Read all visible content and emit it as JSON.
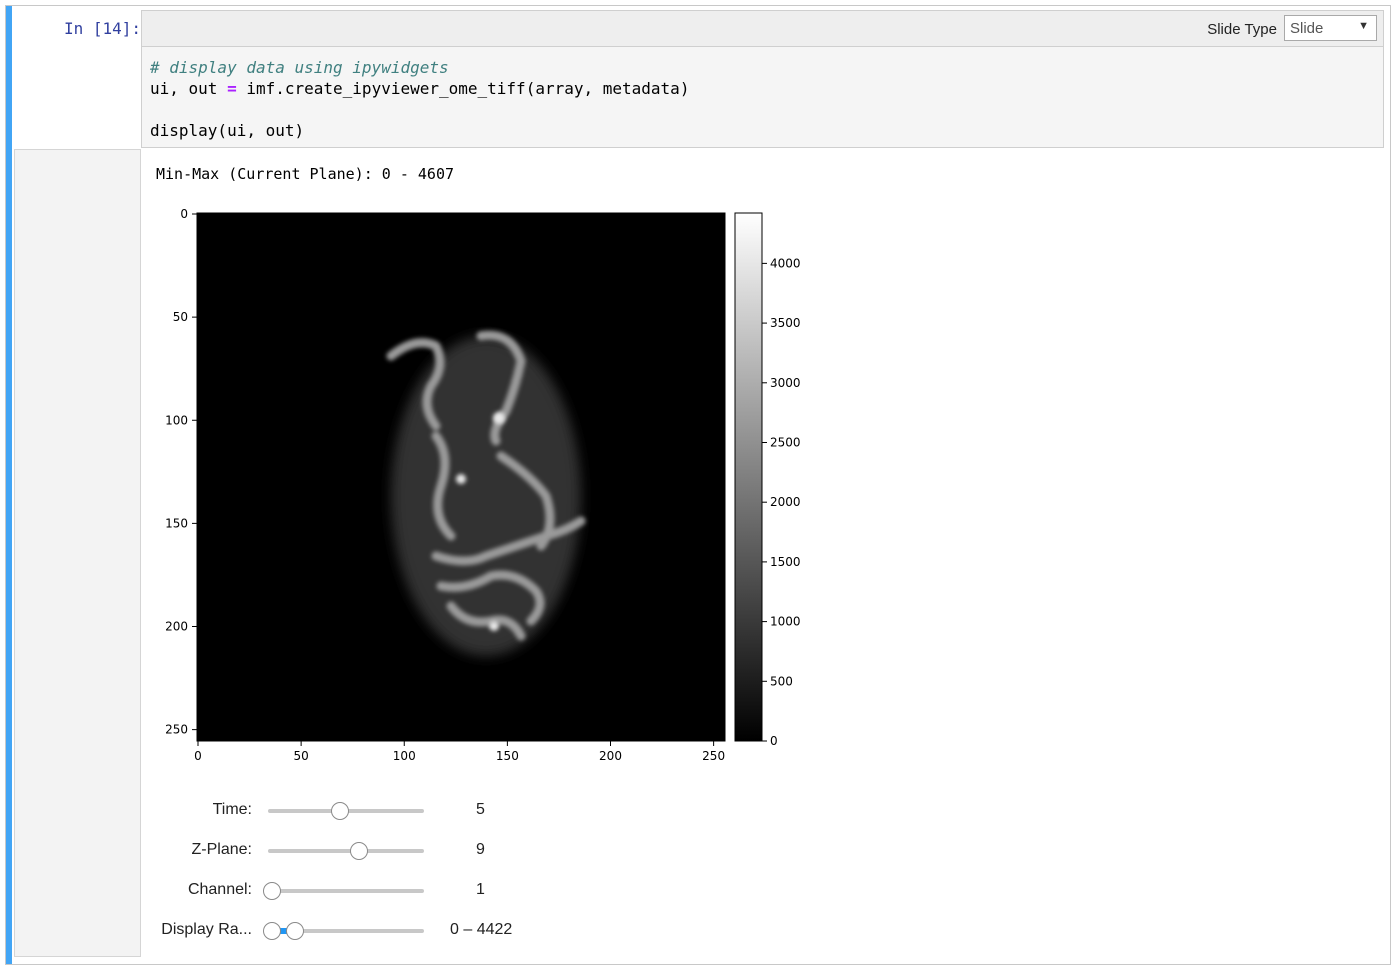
{
  "cell": {
    "prompt": "In [14]:",
    "toolbar": {
      "slide_type_label": "Slide Type",
      "slide_type_value": "Slide"
    },
    "code": {
      "comment": "# display data using ipywidgets",
      "line2_a": "ui, out ",
      "line2_op": "=",
      "line2_b": " imf.create_ipyviewer_ome_tiff(array, metadata)",
      "line4": "display(ui, out)"
    }
  },
  "output": {
    "minmax_text": "Min-Max (Current Plane): 0 - 4607",
    "plot": {
      "image_description_icon": "grayscale-microscopy-image",
      "x_ticks": [
        "0",
        "50",
        "100",
        "150",
        "200",
        "250"
      ],
      "y_ticks": [
        "0",
        "50",
        "100",
        "150",
        "200",
        "250"
      ],
      "colorbar_ticks": [
        "0",
        "500",
        "1000",
        "1500",
        "2000",
        "2500",
        "3000",
        "3500",
        "4000"
      ],
      "colorbar_range": [
        0,
        4422
      ],
      "colormap": "gray"
    },
    "widgets": [
      {
        "label": "Time:",
        "value": "5"
      },
      {
        "label": "Z-Plane:",
        "value": "9"
      },
      {
        "label": "Channel:",
        "value": "1"
      },
      {
        "label": "Display Ra...",
        "value": "0 – 4422"
      }
    ]
  },
  "colors": {
    "accent": "#42a5f5",
    "range_fill": "#2196f3",
    "prompt": "#303f9f"
  }
}
